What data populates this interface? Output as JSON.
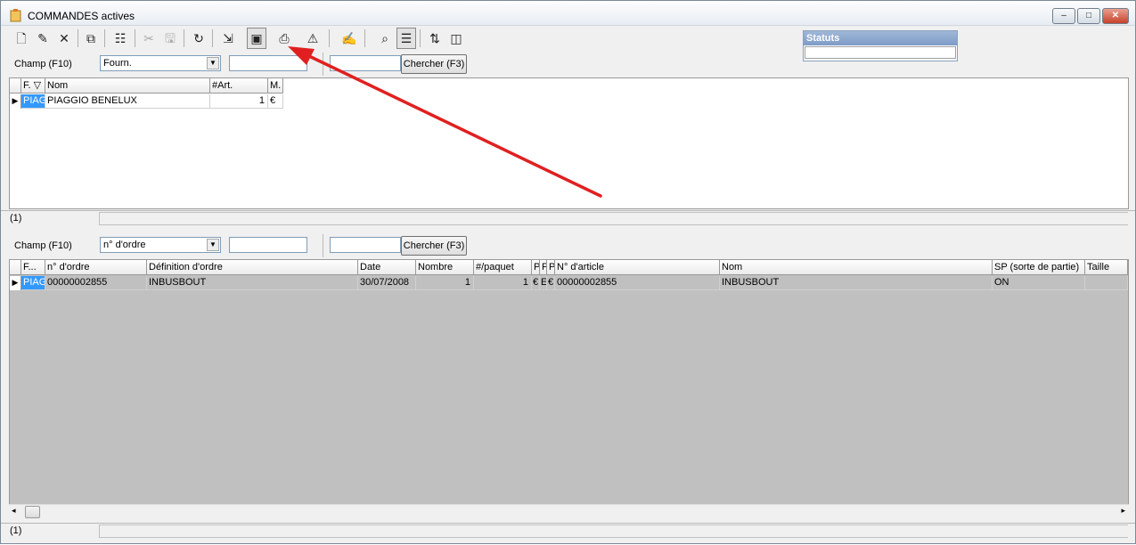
{
  "window": {
    "title": "COMMANDES actives",
    "buttons": {
      "minimize": "–",
      "maximize": "□",
      "close": "✕"
    }
  },
  "toolbar": {
    "items": [
      {
        "name": "new-icon",
        "glyph": "🗋"
      },
      {
        "name": "edit-icon",
        "glyph": "✎"
      },
      {
        "name": "delete-icon",
        "glyph": "✕"
      },
      {
        "name": "copy-icon",
        "glyph": "⧉"
      },
      {
        "name": "properties-icon",
        "glyph": "☷"
      },
      {
        "name": "cut-icon",
        "glyph": "✂"
      },
      {
        "name": "save-icon",
        "glyph": "🖫"
      },
      {
        "name": "refresh-icon",
        "glyph": "↻"
      },
      {
        "name": "import-icon",
        "glyph": "⇲"
      },
      {
        "name": "preview-icon",
        "glyph": "▣"
      },
      {
        "name": "print-icon",
        "glyph": "⎙"
      },
      {
        "name": "alert-icon",
        "glyph": "⚠"
      },
      {
        "name": "draw-icon",
        "glyph": "✍"
      },
      {
        "name": "find-icon",
        "glyph": "⌕"
      },
      {
        "name": "list-view-icon",
        "glyph": "☰"
      },
      {
        "name": "sort-icon",
        "glyph": "⇅"
      },
      {
        "name": "columns-icon",
        "glyph": "◫"
      }
    ]
  },
  "statuts": {
    "label": "Statuts",
    "value": ""
  },
  "search_top": {
    "field_label": "Champ (F10)",
    "field_value": "Fourn.",
    "input1": "",
    "input2": "",
    "button": "Chercher (F3)"
  },
  "grid_top": {
    "headers": [
      "F. ▽",
      "Nom",
      "#Art.",
      "M."
    ],
    "rows": [
      {
        "f": "PIAG",
        "nom": "PIAGGIO BENELUX",
        "art": "1",
        "m": "€"
      }
    ]
  },
  "status_top": {
    "count": "(1)"
  },
  "search_bottom": {
    "field_label": "Champ (F10)",
    "field_value": "n° d'ordre",
    "input1": "",
    "input2": "",
    "button": "Chercher (F3)"
  },
  "grid_bottom": {
    "headers": [
      "F...",
      "n° d'ordre",
      "Définition d'ordre",
      "Date",
      "Nombre",
      "#/paquet",
      "P",
      "F",
      "P",
      "N° d'article",
      "Nom",
      "SP (sorte de partie)",
      "Taille"
    ],
    "rows": [
      {
        "f": "PIAG",
        "ordre": "00000002855",
        "def": "INBUSBOUT",
        "date": "30/07/2008",
        "nombre": "1",
        "paquet": "1",
        "p1": "€",
        "f2": "E",
        "p2": "€",
        "article": "00000002855",
        "nom": "INBUSBOUT",
        "sp": "ON",
        "taille": ""
      }
    ]
  },
  "status_bottom": {
    "count": "(1)"
  },
  "colors": {
    "annotation_arrow": "#e02020",
    "selection": "#3399ff",
    "empty_grid": "#c0c0c0"
  }
}
